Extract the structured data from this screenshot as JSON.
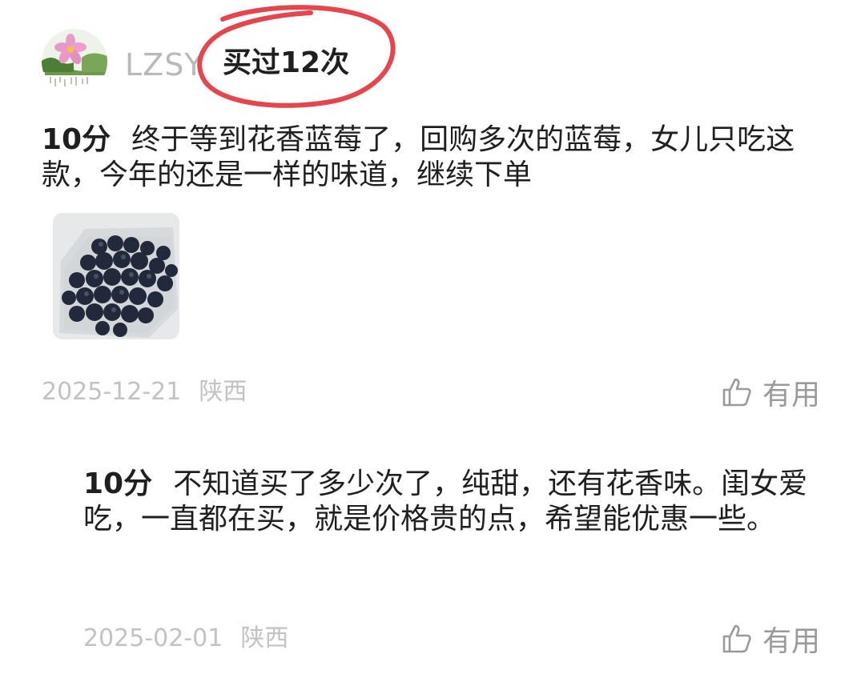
{
  "header": {
    "username": "LZSY",
    "purchase_badge": "买过12次",
    "avatar_icon": "pink-cosmos-flower-avatar"
  },
  "reviews": [
    {
      "score": "10分",
      "text": "终于等到花香蓝莓了，回购多次的蓝莓，女儿只吃这款，今年的还是一样的味道，继续下单",
      "date": "2025-12-21",
      "region": "陕西",
      "useful_label": "有用",
      "photo_icon": "blueberries-in-container-photo"
    },
    {
      "score": "10分",
      "text": "不知道买了多少次了，纯甜，还有花香味。闺女爱吃，一直都在买，就是价格贵的点，希望能优惠一些。",
      "date": "2025-02-01",
      "region": "陕西",
      "useful_label": "有用"
    }
  ],
  "colors": {
    "highlight_circle": "#e4464c",
    "meta_text": "#c2c2c2",
    "username_text": "#b9b9b9"
  }
}
